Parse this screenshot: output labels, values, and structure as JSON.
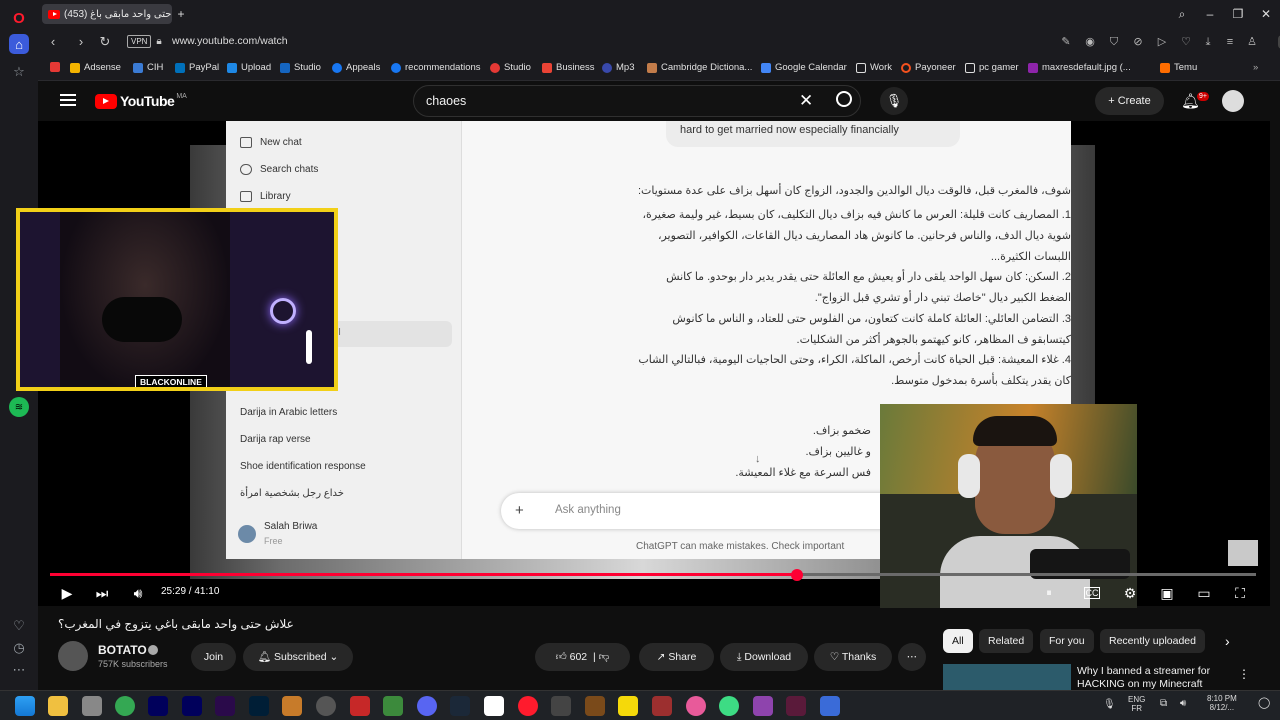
{
  "browser": {
    "tab_title": "(453) علاش حتى واحد مابقى باغ...",
    "url": "www.youtube.com/watch",
    "vpn_label": "VPN",
    "bookmarks": [
      "Adsense",
      "CIH",
      "PayPal",
      "Upload",
      "Studio",
      "Appeals",
      "recommendations",
      "Studio",
      "Business",
      "Mp3",
      "Cambridge Dictiona...",
      "Google Calendar",
      "Work",
      "Payoneer",
      "pc gamer",
      "maxresdefault.jpg (...",
      "Temu"
    ]
  },
  "youtube": {
    "logo": "YouTube",
    "region": "MA",
    "search_query": "chaoes",
    "create_label": "Create",
    "notif_count": "9+"
  },
  "chatgpt": {
    "sidebar": {
      "new_chat": "New chat",
      "search_chats": "Search chats",
      "library": "Library",
      "partial_item": "انخ",
      "history": [
        "Darija in Arabic letters",
        "Darija rap verse",
        "Shoe identification response",
        "خداع رجل بشخصية امرأة"
      ],
      "user_name": "Salah Briwa",
      "user_plan": "Free"
    },
    "user_message": "hard to get married now especially financially",
    "answer_lines": [
      "شوف، فالمغرب قبل، فالوقت ديال الوالدين والجدود، الزواج كان أسهل بزاف على عدة مستويات:",
      "1. المصاريف كانت قليلة: العرس ما كانش فيه بزاف ديال التكليف، كان بسيط، غير وليمة صغيرة،",
      "شوية ديال الدف، والناس فرحانين. ما كانوش هاد المصاريف ديال القاعات، الكوافير، التصوير،",
      "اللبسات الكثيرة...",
      "2. السكن: كان سهل الواحد يلقى دار أو يعيش مع العائلة حتى يقدر يدير دار بوحدو. ما كانش",
      "الضغط الكبير ديال \"خاصك تبني دار أو تشري قبل الزواج\".",
      "3. التضامن العائلي: العائلة كاملة كانت كتعاون، من الفلوس حتى للعتاد، و الناس ما كانوش",
      "كيتسابقو ف المظاهر، كانو كيهتمو بالجوهر أكثر من الشكليات.",
      "4. غلاء المعيشة: قبل الحياة كانت أرخص، الماكلة، الكراء، وحتى الحاجيات اليومية، فبالتالي الشاب",
      "كان يقدر يتكلف بأسرة بمدخول متوسط."
    ],
    "lower_lines": [
      "ضخمو بزاف.",
      "و غاليين بزاف.",
      "فس السرعة مع غلاء المعيشة."
    ],
    "input_placeholder": "Ask anything",
    "disclaimer": "ChatGPT can make mistakes. Check important"
  },
  "webcam_label": "BLACKONLINE",
  "player": {
    "time": "25:29 / 41:10",
    "progress": 0.619
  },
  "video": {
    "title": "علاش حتى واحد مابقى باغي يتزوج في المغرب؟",
    "channel": "BOTATO",
    "subscribers": "757K subscribers",
    "join": "Join",
    "subscribed": "Subscribed",
    "likes": "602",
    "share": "Share",
    "download": "Download",
    "thanks": "Thanks"
  },
  "recommendations": {
    "chips": [
      "All",
      "Related",
      "For you",
      "Recently uploaded"
    ],
    "first_title": "Why I banned a streamer for HACKING on my Minecraft"
  },
  "taskbar": {
    "lang": "ENG",
    "lang2": "FR",
    "time": "8:10 PM",
    "date": "8/12/..."
  },
  "colors": {
    "accent": "#ff0033",
    "webcam_border": "#f2d018"
  }
}
